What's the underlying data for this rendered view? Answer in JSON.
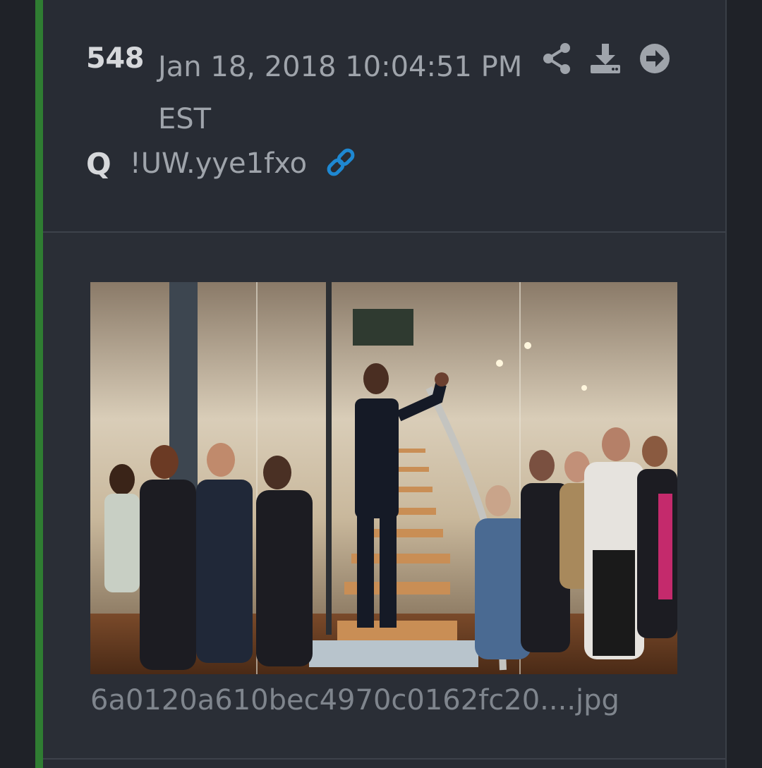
{
  "post": {
    "number": "548",
    "date": "Jan 18, 2018 10:04:51 PM EST",
    "author": "Q",
    "tripcode": "!UW.yye1fxo",
    "actions": [
      "share-icon",
      "download-icon",
      "go-to-post-icon"
    ],
    "author_link_icon": "link-icon",
    "attachment": {
      "filename": "6a0120a610bec4970c0162fc20....jpg"
    }
  },
  "colors": {
    "accent": "#2f7d32",
    "background": "#282c34",
    "link": "#1e88d2",
    "muted_text": "#9fa4ab"
  }
}
